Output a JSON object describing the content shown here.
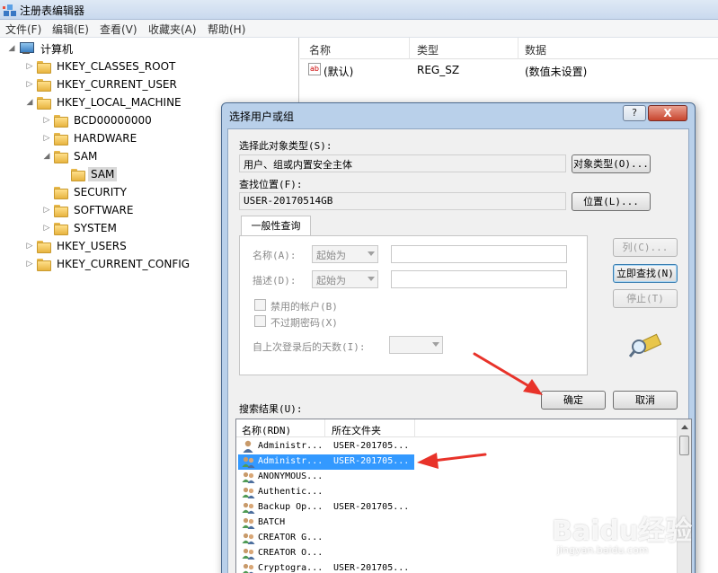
{
  "window": {
    "title": "注册表编辑器",
    "icon": "registry-editor-icon"
  },
  "menu": [
    "文件(F)",
    "编辑(E)",
    "查看(V)",
    "收藏夹(A)",
    "帮助(H)"
  ],
  "tree": {
    "root": "计算机",
    "hives": [
      "HKEY_CLASSES_ROOT",
      "HKEY_CURRENT_USER",
      "HKEY_LOCAL_MACHINE"
    ],
    "hklm_children": [
      "BCD00000000",
      "HARDWARE",
      "SAM"
    ],
    "sam_child": "SAM",
    "hklm_more": [
      "SECURITY",
      "SOFTWARE",
      "SYSTEM"
    ],
    "other_hives": [
      "HKEY_USERS",
      "HKEY_CURRENT_CONFIG"
    ]
  },
  "list": {
    "columns": [
      "名称",
      "类型",
      "数据"
    ],
    "rows": [
      {
        "name": "(默认)",
        "type": "REG_SZ",
        "data": "(数值未设置)"
      }
    ]
  },
  "dialog": {
    "title": "选择用户或组",
    "help": "?",
    "close": "X",
    "object_type_label": "选择此对象类型(S):",
    "object_type_value": "用户、组或内置安全主体",
    "object_type_button": "对象类型(O)...",
    "location_label": "查找位置(F):",
    "location_value": "USER-20170514GB",
    "location_button": "位置(L)...",
    "tab": "一般性查询",
    "name_label": "名称(A):",
    "name_combo": "起始为",
    "desc_label": "描述(D):",
    "desc_combo": "起始为",
    "disabled_accounts": "禁用的帐户(B)",
    "no_expire": "不过期密码(X)",
    "days_label": "自上次登录后的天数(I):",
    "columns_button": "列(C)...",
    "find_now_button": "立即查找(N)",
    "stop_button": "停止(T)",
    "ok_button": "确定",
    "cancel_button": "取消",
    "results_label": "搜索结果(U):",
    "results_columns": [
      "名称(RDN)",
      "所在文件夹"
    ],
    "results": [
      {
        "name": "Administr...",
        "folder": "USER-201705...",
        "icon": "user-icon"
      },
      {
        "name": "Administr...",
        "folder": "USER-201705...",
        "icon": "group-icon"
      },
      {
        "name": "ANONYMOUS...",
        "folder": "",
        "icon": "group-icon"
      },
      {
        "name": "Authentic...",
        "folder": "",
        "icon": "group-icon"
      },
      {
        "name": "Backup Op...",
        "folder": "USER-201705...",
        "icon": "group-icon"
      },
      {
        "name": "BATCH",
        "folder": "",
        "icon": "group-icon"
      },
      {
        "name": "CREATOR G...",
        "folder": "",
        "icon": "group-icon"
      },
      {
        "name": "CREATOR O...",
        "folder": "",
        "icon": "group-icon"
      },
      {
        "name": "Cryptogra...",
        "folder": "USER-201705...",
        "icon": "group-icon"
      }
    ],
    "selected_result_index": 1
  },
  "watermark": {
    "main": "Baidu经验",
    "sub": "jingyan.baidu.com"
  },
  "colors": {
    "selection": "#3399ff",
    "annotation_arrow": "#e8332a",
    "dialog_frame": "#b9d0ea"
  }
}
